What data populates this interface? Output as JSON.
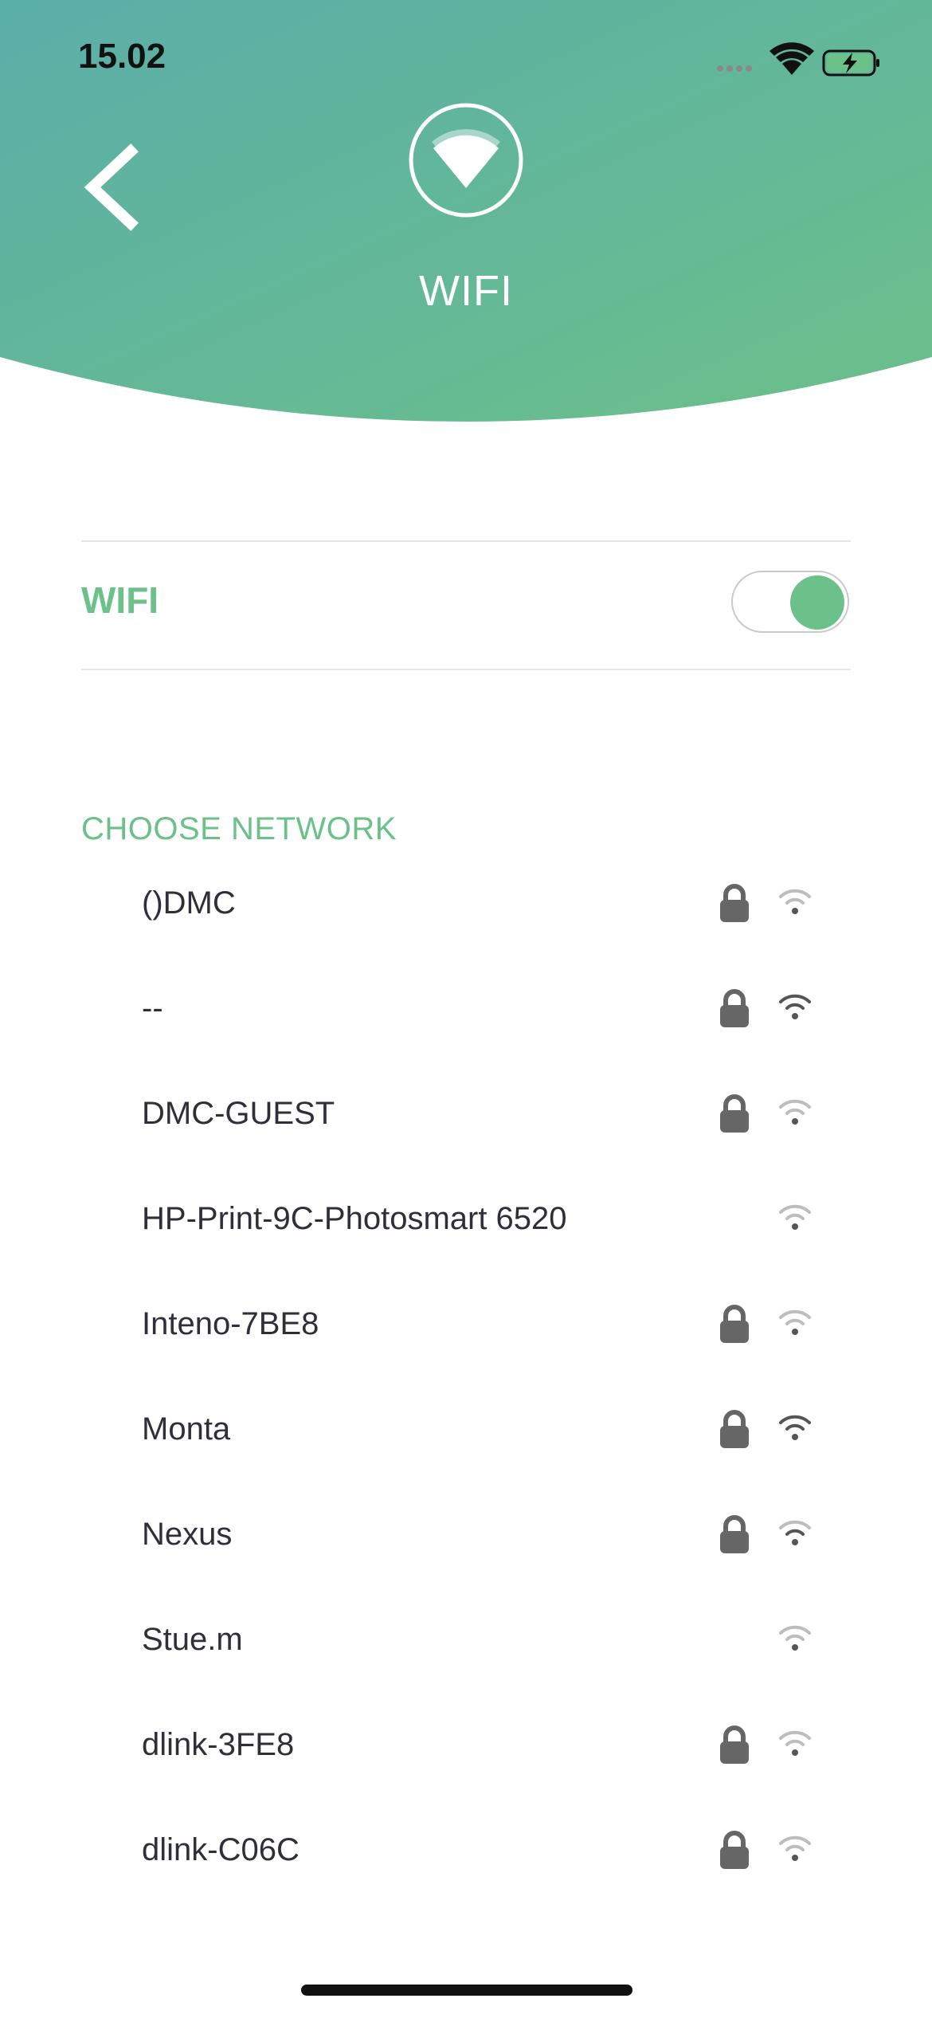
{
  "status_bar": {
    "time": "15.02"
  },
  "header": {
    "title": "WIFI"
  },
  "wifi_setting": {
    "label": "WIFI",
    "enabled": true
  },
  "networks_section": {
    "heading": "CHOOSE NETWORK"
  },
  "networks": [
    {
      "name": "()DMC",
      "locked": true,
      "signal": "weak"
    },
    {
      "name": "--",
      "locked": true,
      "signal": "strong"
    },
    {
      "name": "DMC-GUEST",
      "locked": true,
      "signal": "weak"
    },
    {
      "name": "HP-Print-9C-Photosmart 6520",
      "locked": false,
      "signal": "weak"
    },
    {
      "name": "Inteno-7BE8",
      "locked": true,
      "signal": "weak"
    },
    {
      "name": "Monta",
      "locked": true,
      "signal": "strong"
    },
    {
      "name": "Nexus",
      "locked": true,
      "signal": "medium"
    },
    {
      "name": "Stue.m",
      "locked": false,
      "signal": "weak"
    },
    {
      "name": "dlink-3FE8",
      "locked": true,
      "signal": "weak"
    },
    {
      "name": "dlink-C06C",
      "locked": true,
      "signal": "weak"
    }
  ],
  "colors": {
    "accent": "#6cc08a",
    "gradient_start": "#5aaea8",
    "gradient_end": "#6cc08a"
  },
  "icons": {
    "back": "chevron-left-icon",
    "header": "wifi-icon",
    "lock": "lock-icon",
    "signal": "wifi-signal-icon"
  }
}
